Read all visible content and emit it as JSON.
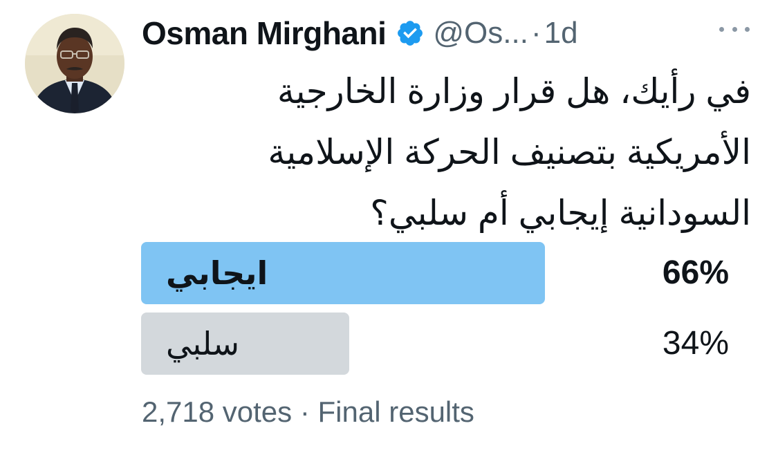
{
  "tweet": {
    "author": {
      "display_name": "Osman Mirghani",
      "handle": "@Os...",
      "verified": true,
      "avatar_icon": "profile-photo"
    },
    "separator": "·",
    "time": "1d",
    "more_icon": "more-horizontal-icon",
    "text_lines": [
      "في رأيك، هل قرار وزارة الخارجية",
      "الأمريكية بتصنيف الحركة الإسلامية",
      "السودانية إيجابي أم سلبي؟"
    ]
  },
  "poll": {
    "options": [
      {
        "label": "ايجابي",
        "percent_text": "66%",
        "percent": 66,
        "winner": true,
        "bar_color": "#7fc4f3"
      },
      {
        "label": "سلبي",
        "percent_text": "34%",
        "percent": 34,
        "winner": false,
        "bar_color": "#d3d8dc"
      }
    ],
    "footer": {
      "votes": "2,718 votes",
      "separator": "·",
      "status": "Final results"
    }
  },
  "colors": {
    "verified_badge": "#1d9bf0",
    "secondary_text": "#536471"
  }
}
